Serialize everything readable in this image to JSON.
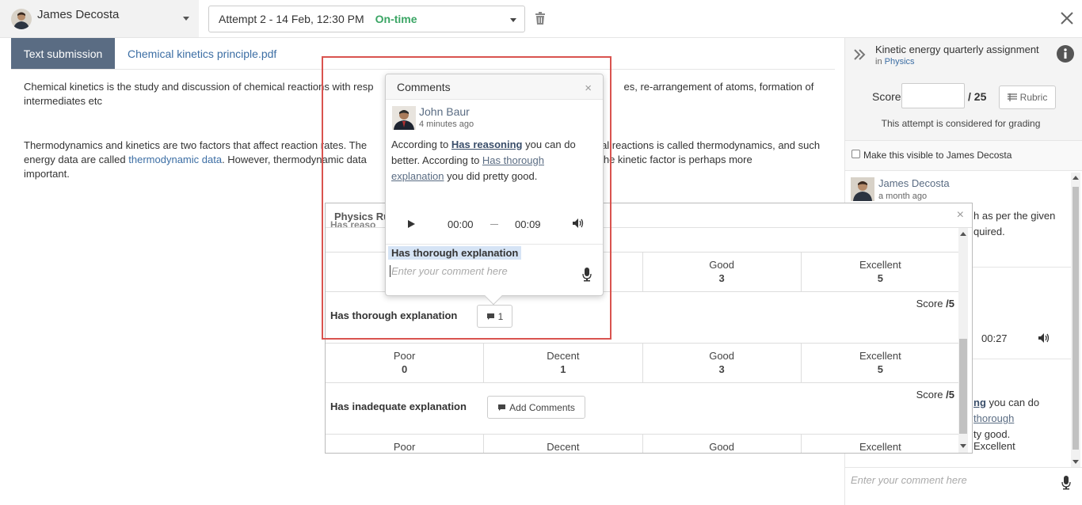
{
  "header": {
    "student_name": "James Decosta",
    "attempt_label": "Attempt 2 - 14 Feb, 12:30 PM",
    "attempt_status": "On-time",
    "status_color": "#3aa564"
  },
  "tabs": [
    {
      "label": "Text submission",
      "active": true
    },
    {
      "label": "Chemical kinetics principle.pdf",
      "active": false
    }
  ],
  "document": {
    "p1": "Chemical kinetics is the study and discussion of chemical reactions with resp",
    "p1_tail": "es, re-arrangement of atoms, formation of",
    "p1_line2": "intermediates etc",
    "p2_a": "Thermodynamics and kinetics are two factors that affect reaction rates. The",
    "p2_tail": "al reactions is called thermodynamics, and such",
    "p2_line2a": "energy data are called",
    "p2_link": "thermodynamic data",
    "p2_line2b": ". However, thermo",
    "p2_line2c": "dynamic data",
    "p2_tail2": "s, for which the kinetic factor is perhaps more",
    "p2_line3": "important."
  },
  "comments_popover": {
    "title": "Comments",
    "author": "John Baur",
    "time": "4 minutes ago",
    "text_a": "According to",
    "link1": "Has reasoning",
    "text_b": "you can do better. According to",
    "link2": "Has thorough explanation",
    "text_c": "you did pretty good.",
    "audio_current": "00:00",
    "audio_duration": "00:09",
    "tag": "Has thorough explanation",
    "input_placeholder": "Enter your comment here"
  },
  "rubric": {
    "title": "Physics Ru",
    "partial_criterion": "Has reaso",
    "rows": [
      {
        "levels": [
          {
            "label": "",
            "points": ""
          },
          {
            "label": "",
            "points": ""
          },
          {
            "label": "Good",
            "points": "3"
          },
          {
            "label": "Excellent",
            "points": "5"
          }
        ]
      },
      {
        "criterion": "Has thorough explanation",
        "score_label": "Score",
        "score_max": "/5",
        "comment_count": "1",
        "levels": [
          {
            "label": "Poor",
            "points": "0"
          },
          {
            "label": "Decent",
            "points": "1"
          },
          {
            "label": "Good",
            "points": "3"
          },
          {
            "label": "Excellent",
            "points": "5"
          }
        ]
      },
      {
        "criterion": "Has inadequate explanation",
        "score_label": "Score",
        "score_max": "/5",
        "button_label": "Add Comments",
        "levels": [
          {
            "label": "Poor"
          },
          {
            "label": "Decent"
          },
          {
            "label": "Good"
          },
          {
            "label": "Excellent"
          }
        ]
      }
    ]
  },
  "sidebar": {
    "assignment_title": "Kinetic energy quarterly assignment",
    "in_label": "in",
    "course": "Physics",
    "score_label": "Score",
    "score_value": "",
    "score_max": "/ 25",
    "rubric_button": "Rubric",
    "grading_note": "This attempt is considered for grading",
    "visible_label": "Make this visible to James Decosta",
    "feed": {
      "author": "James Decosta",
      "time": "a month ago",
      "text1": "h as per the given",
      "text2": "quired.",
      "audio_time": "00:27",
      "link_a": "ng",
      "text3": "you can do",
      "link_b": "thorough",
      "text4": "ty good.",
      "text5": "Excellent"
    },
    "input_placeholder": "Enter your comment here"
  }
}
